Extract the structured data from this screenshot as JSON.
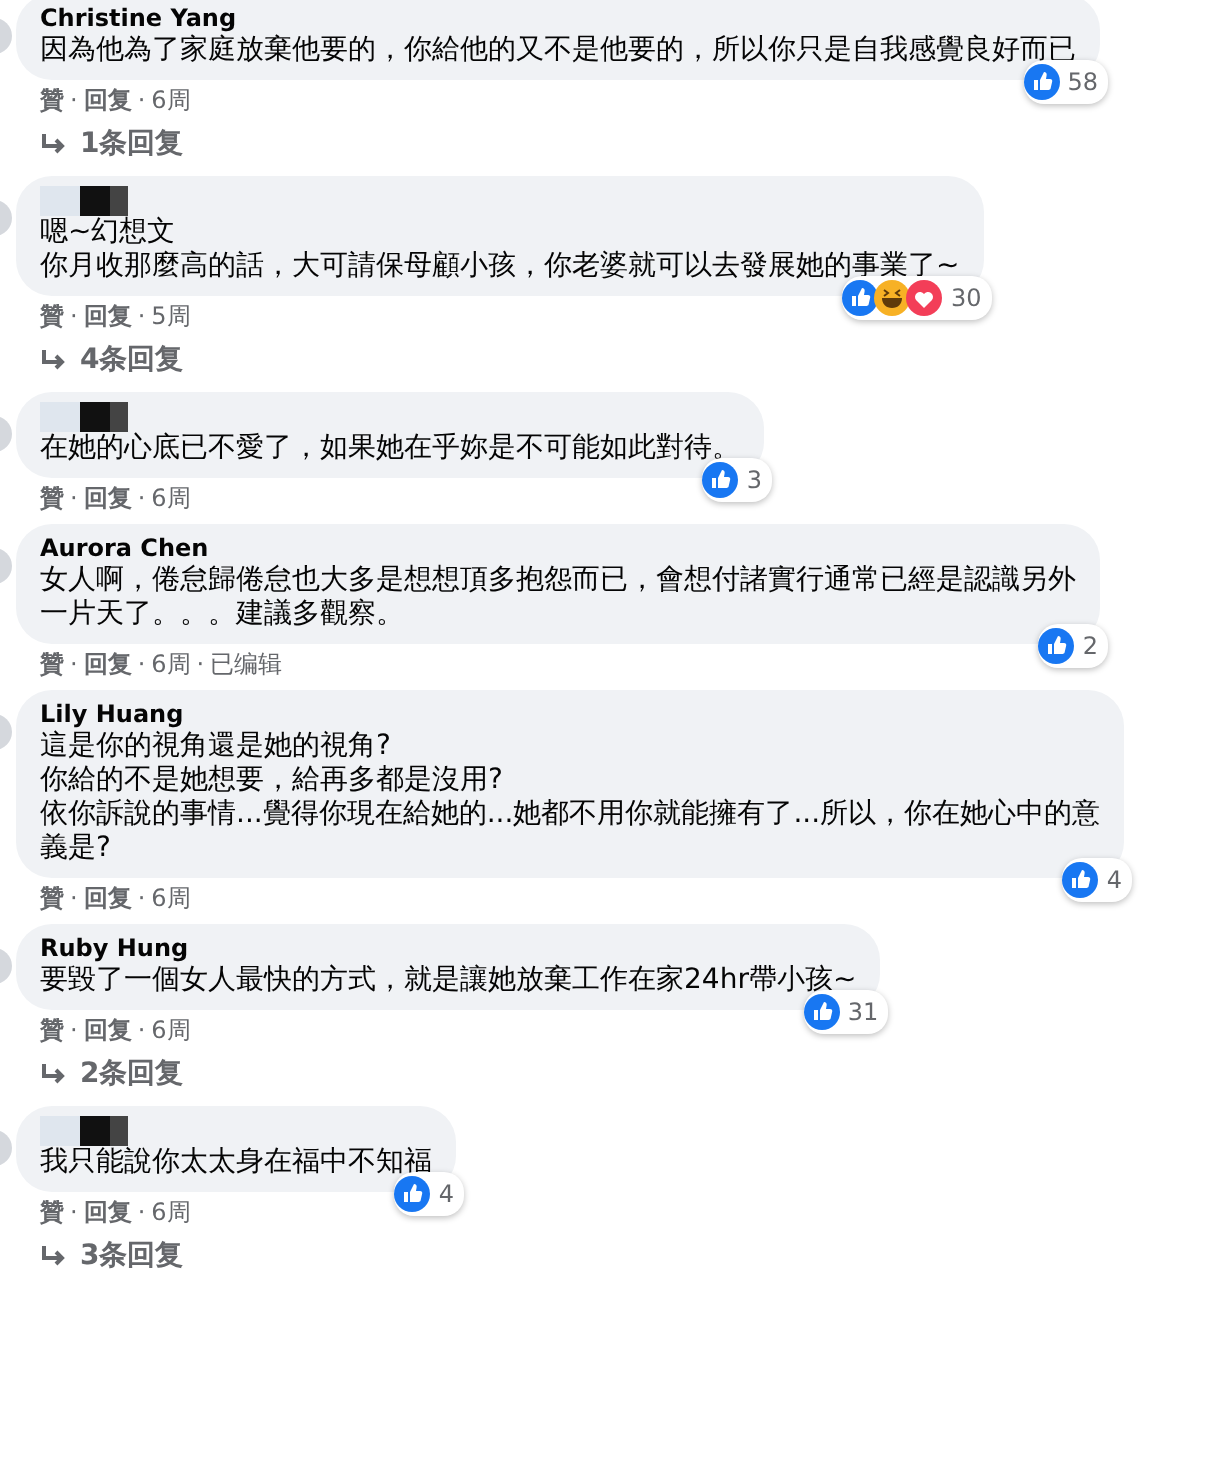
{
  "separator": "·",
  "comments": [
    {
      "author": "Christine Yang",
      "lines": [
        "因為他為了家庭放棄他要的，你給他的又不是他要的，所以你只是自我感覺良好而已"
      ],
      "reactions": [
        {
          "kind": "like"
        }
      ],
      "count": "58",
      "actions": [
        "贊",
        "回复",
        "6周"
      ],
      "replies": "1条回复"
    },
    {
      "name_hidden": true,
      "lines": [
        "嗯~幻想文",
        "你月收那麼高的話，大可請保母顧小孩，你老婆就可以去發展她的事業了~"
      ],
      "reactions": [
        {
          "kind": "like"
        },
        {
          "kind": "haha"
        },
        {
          "kind": "love"
        }
      ],
      "count": "30",
      "actions": [
        "贊",
        "回复",
        "5周"
      ],
      "replies": "4条回复"
    },
    {
      "name_hidden": true,
      "lines": [
        "在她的心底已不愛了，如果她在乎妳是不可能如此對待。"
      ],
      "reactions": [
        {
          "kind": "like"
        }
      ],
      "count": "3",
      "actions": [
        "贊",
        "回复",
        "6周"
      ]
    },
    {
      "author": "Aurora Chen",
      "lines": [
        "女人啊，倦怠歸倦怠也大多是想想頂多抱怨而已，會想付諸實行通常已經是認識另外",
        "一片天了。。。建議多觀察。"
      ],
      "reactions": [
        {
          "kind": "like"
        }
      ],
      "count": "2",
      "actions": [
        "贊",
        "回复",
        "6周",
        "已编辑"
      ]
    },
    {
      "author": "Lily Huang",
      "lines": [
        "這是你的視角還是她的視角?",
        "你給的不是她想要，給再多都是沒用?",
        "依你訴說的事情...覺得你現在給她的...她都不用你就能擁有了...所以，你在她心中的意",
        "義是?"
      ],
      "reactions": [
        {
          "kind": "like"
        }
      ],
      "count": "4",
      "actions": [
        "贊",
        "回复",
        "6周"
      ]
    },
    {
      "author": "Ruby Hung",
      "lines": [
        "要毀了一個女人最快的方式，就是讓她放棄工作在家24hr帶小孩~"
      ],
      "reactions": [
        {
          "kind": "like"
        }
      ],
      "count": "31",
      "actions": [
        "贊",
        "回复",
        "6周"
      ],
      "replies": "2条回复"
    },
    {
      "name_hidden": true,
      "lines": [
        "我只能說你太太身在福中不知福"
      ],
      "reactions": [
        {
          "kind": "like"
        }
      ],
      "count": "4",
      "actions": [
        "贊",
        "回复",
        "6周"
      ],
      "replies": "3条回复"
    }
  ]
}
